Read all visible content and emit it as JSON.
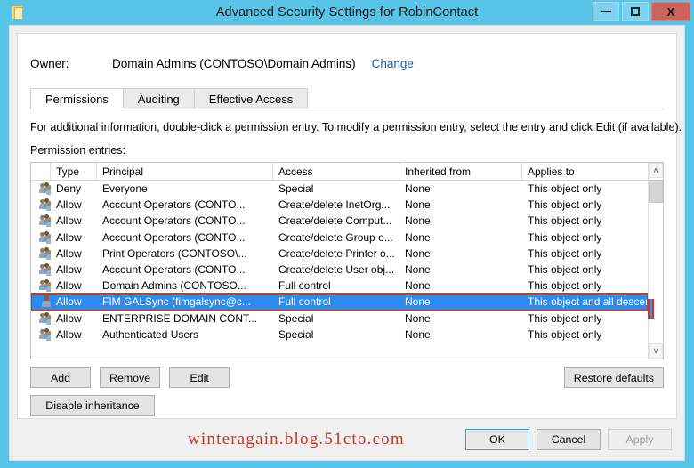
{
  "window": {
    "title": "Advanced Security Settings for RobinContact",
    "icon": "folder-icon",
    "minimize_label": "–",
    "maximize_label": "□",
    "close_label": "X",
    "titlebar_color": "#58c4e8",
    "close_color": "#c8645c"
  },
  "owner": {
    "label": "Owner:",
    "value": "Domain Admins (CONTOSO\\Domain Admins)",
    "change_link": "Change",
    "link_color": "#1763a8"
  },
  "tabs": [
    {
      "label": "Permissions",
      "active": true
    },
    {
      "label": "Auditing",
      "active": false
    },
    {
      "label": "Effective Access",
      "active": false
    }
  ],
  "info_text": "For additional information, double-click a permission entry. To modify a permission entry, select the entry and click Edit (if available).",
  "entries_label": "Permission entries:",
  "table": {
    "columns": [
      "",
      "Type",
      "Principal",
      "Access",
      "Inherited from",
      "Applies to"
    ],
    "selection_color": "#2b8cf0",
    "annotation_color": "#c0392b",
    "rows": [
      {
        "icon": "group-icon",
        "type": "Deny",
        "principal": "Everyone",
        "access": "Special",
        "inherited": "None",
        "applies": "This object only",
        "selected": false
      },
      {
        "icon": "group-icon",
        "type": "Allow",
        "principal": "Account Operators (CONTO...",
        "access": "Create/delete InetOrg...",
        "inherited": "None",
        "applies": "This object only",
        "selected": false
      },
      {
        "icon": "group-icon",
        "type": "Allow",
        "principal": "Account Operators (CONTO...",
        "access": "Create/delete Comput...",
        "inherited": "None",
        "applies": "This object only",
        "selected": false
      },
      {
        "icon": "group-icon",
        "type": "Allow",
        "principal": "Account Operators (CONTO...",
        "access": "Create/delete Group o...",
        "inherited": "None",
        "applies": "This object only",
        "selected": false
      },
      {
        "icon": "group-icon",
        "type": "Allow",
        "principal": "Print Operators (CONTOSO\\...",
        "access": "Create/delete Printer o...",
        "inherited": "None",
        "applies": "This object only",
        "selected": false
      },
      {
        "icon": "group-icon",
        "type": "Allow",
        "principal": "Account Operators (CONTO...",
        "access": "Create/delete User obj...",
        "inherited": "None",
        "applies": "This object only",
        "selected": false
      },
      {
        "icon": "group-icon",
        "type": "Allow",
        "principal": "Domain Admins (CONTOSO...",
        "access": "Full control",
        "inherited": "None",
        "applies": "This object only",
        "selected": false
      },
      {
        "icon": "user-icon",
        "type": "Allow",
        "principal": "FIM GALSync (fimgalsync@c...",
        "access": "Full control",
        "inherited": "None",
        "applies": "This object and all descendan...",
        "selected": true
      },
      {
        "icon": "group-icon",
        "type": "Allow",
        "principal": "ENTERPRISE DOMAIN CONT...",
        "access": "Special",
        "inherited": "None",
        "applies": "This object only",
        "selected": false
      },
      {
        "icon": "group-icon",
        "type": "Allow",
        "principal": "Authenticated Users",
        "access": "Special",
        "inherited": "None",
        "applies": "This object only",
        "selected": false
      }
    ],
    "scrollbar": {
      "up_glyph": "∧",
      "down_glyph": "∨"
    }
  },
  "buttons": {
    "add": "Add",
    "remove": "Remove",
    "edit": "Edit",
    "restore_defaults": "Restore defaults",
    "disable_inheritance": "Disable inheritance"
  },
  "footer": {
    "ok": "OK",
    "cancel": "Cancel",
    "apply": "Apply",
    "apply_disabled": true,
    "watermark": "winteragain.blog.51cto.com",
    "watermark_color": "#c0392b"
  }
}
